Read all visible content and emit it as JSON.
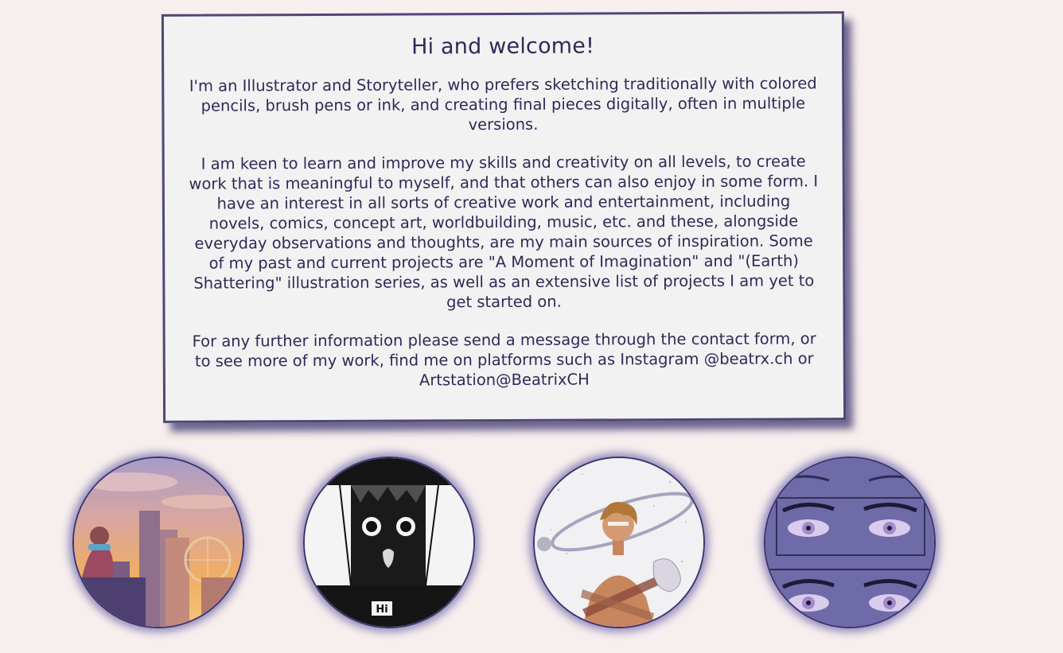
{
  "welcome": {
    "title": "Hi and welcome!",
    "paragraph1": "I'm an Illustrator and Storyteller, who prefers sketching traditionally with colored pencils, brush pens or ink, and creating final pieces digitally, often in multiple versions.",
    "paragraph2": "I am keen to learn and improve my skills and creativity on all levels, to create work that is meaningful to myself, and that others can also enjoy in some form. I have an interest in all sorts of creative work and entertainment, including novels, comics, concept art, worldbuilding, music, etc. and these, alongside everyday observations and thoughts, are my main sources of inspiration. Some of my past and current projects are \"A Moment of Imagination\" and \"(Earth) Shattering\" illustration series, as well as an extensive list of projects I am yet to get started on.",
    "paragraph3": "For any further information please send a message through the contact form, or to see more of my work, find me on platforms such as Instagram @beatrx.ch or Artstation@BeatrixCH"
  },
  "gallery": {
    "items": [
      {
        "subject": "city sunset with ferris wheel",
        "accent": "#e7a35c"
      },
      {
        "subject": "black cat comic panel",
        "label": "Hi",
        "accent": "#111111"
      },
      {
        "subject": "figure with planetary rings",
        "accent": "#d9a27a"
      },
      {
        "subject": "purple eyes comic panels",
        "accent": "#6f6aa8"
      }
    ]
  },
  "colors": {
    "background": "#f7eeee",
    "card": "#f2f2f3",
    "text": "#2f2a55",
    "border": "#4e4775"
  }
}
